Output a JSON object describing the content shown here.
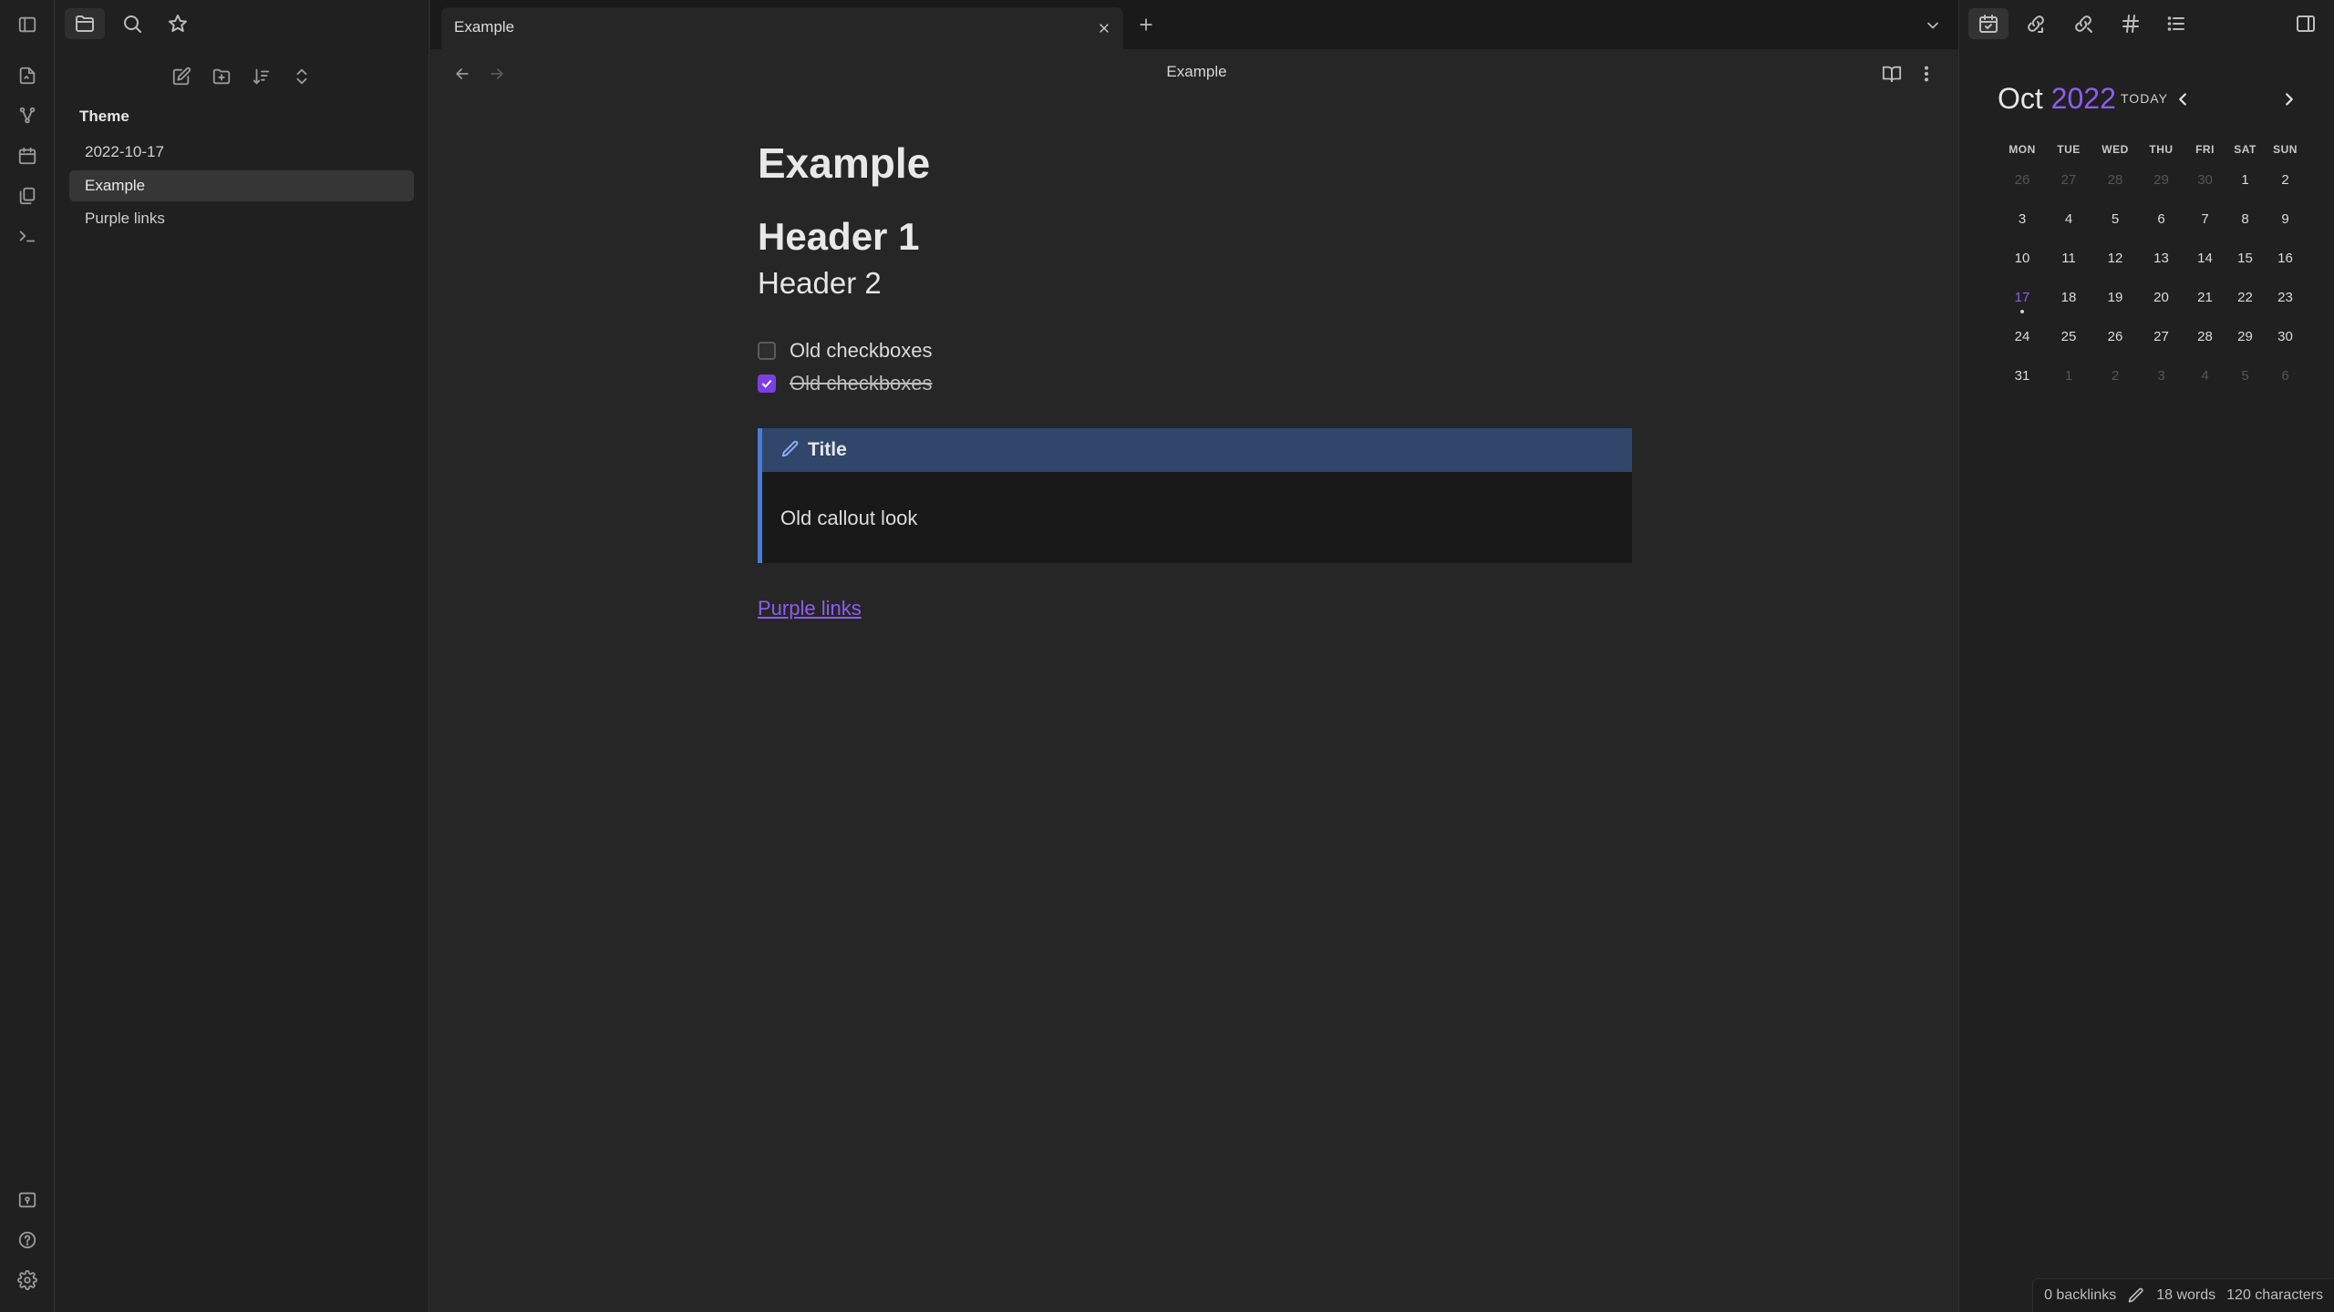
{
  "left_sidebar": {
    "vault_name": "Theme",
    "files": [
      "2022-10-17",
      "Example",
      "Purple links"
    ]
  },
  "tabs": {
    "active_tab": "Example"
  },
  "note": {
    "header_title": "Example",
    "title": "Example",
    "h1": "Header 1",
    "h2": "Header 2",
    "checkbox_unchecked": "Old checkboxes",
    "checkbox_checked": "Old checkboxes",
    "callout_title": "Title",
    "callout_body": "Old callout look",
    "link": "Purple links"
  },
  "calendar": {
    "month": "Oct",
    "year": "2022",
    "today_label": "TODAY",
    "weekdays": [
      "MON",
      "TUE",
      "WED",
      "THU",
      "FRI",
      "SAT",
      "SUN"
    ],
    "weeks": [
      [
        "26",
        "27",
        "28",
        "29",
        "30",
        "1",
        "2"
      ],
      [
        "3",
        "4",
        "5",
        "6",
        "7",
        "8",
        "9"
      ],
      [
        "10",
        "11",
        "12",
        "13",
        "14",
        "15",
        "16"
      ],
      [
        "17",
        "18",
        "19",
        "20",
        "21",
        "22",
        "23"
      ],
      [
        "24",
        "25",
        "26",
        "27",
        "28",
        "29",
        "30"
      ],
      [
        "31",
        "1",
        "2",
        "3",
        "4",
        "5",
        "6"
      ]
    ]
  },
  "status": {
    "backlinks": "0 backlinks",
    "words": "18 words",
    "characters": "120 characters"
  },
  "colors": {
    "accent": "#8f5cf0",
    "checkbox": "#7b3fe4",
    "callout_border": "#4a7bd6",
    "callout_header": "#30466b"
  }
}
